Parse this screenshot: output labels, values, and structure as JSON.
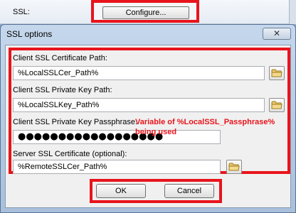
{
  "parent": {
    "ssl_label": "SSL:",
    "configure_label": "Configure..."
  },
  "dialog": {
    "title": "SSL options",
    "close_glyph": "✕"
  },
  "fields": {
    "client_cert_label": "Client SSL Certificate Path:",
    "client_cert_value": "%LocalSSLCer_Path%",
    "client_key_label": "Client SSL Private Key Path:",
    "client_key_value": "%LocalSSLKey_Path%",
    "passphrase_label": "Client SSL Private Key Passphrase:",
    "passphrase_mask": "●●●●●●●●●●●●●●●●●●",
    "server_cert_label": "Server SSL Certificate (optional):",
    "server_cert_value": "%RemoteSSLCer_Path%"
  },
  "annotation": {
    "line1": "Variable of %LocalSSL_Passphrase%",
    "line2": "being used"
  },
  "buttons": {
    "ok": "OK",
    "cancel": "Cancel"
  },
  "colors": {
    "highlight": "#e8141b",
    "folder": "#e9c86b"
  },
  "icons": {
    "browse": "folder-icon",
    "close": "close-icon"
  }
}
